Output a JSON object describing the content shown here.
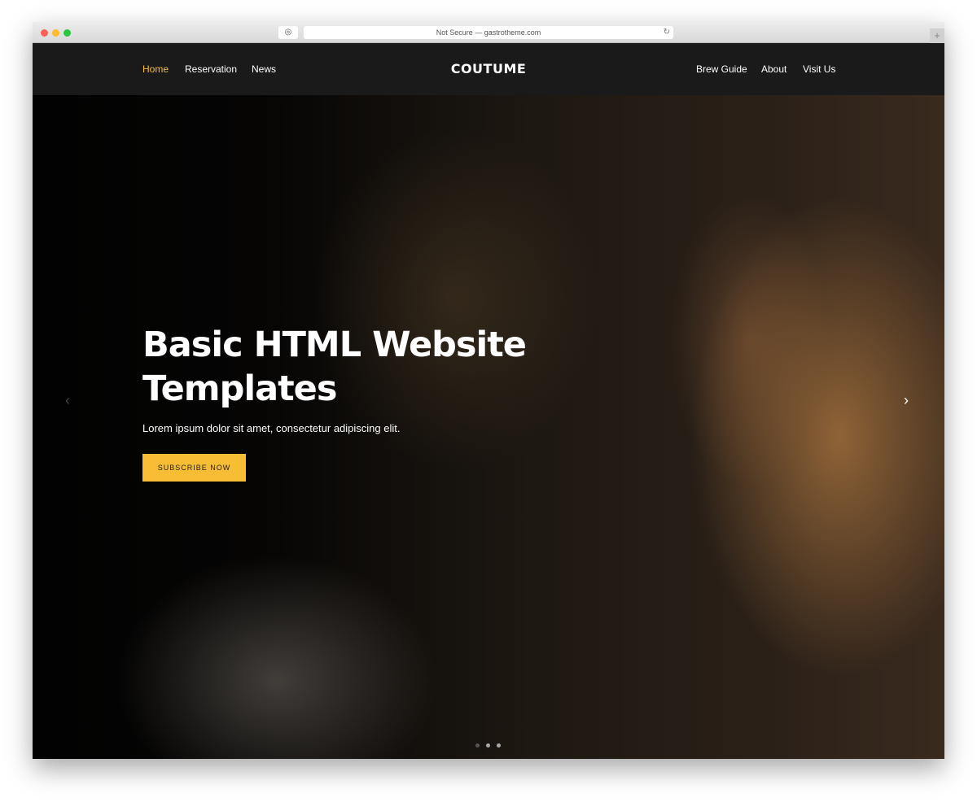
{
  "browser": {
    "url": "Not Secure — gastrotheme.com",
    "reader_icon": "reader-icon",
    "reload_icon": "reload-icon",
    "new_tab": "+"
  },
  "nav": {
    "left": [
      {
        "label": "Home",
        "active": true
      },
      {
        "label": "Reservation"
      },
      {
        "label": "News"
      }
    ],
    "logo": "COUTUME",
    "right": [
      {
        "label": "Brew Guide"
      },
      {
        "label": "About"
      },
      {
        "label": "Visit Us"
      }
    ]
  },
  "hero": {
    "title": "Basic HTML Website Templates",
    "subtitle": "Lorem ipsum dolor sit amet, consectetur adipiscing elit.",
    "button": "SUBSCRIBE NOW",
    "prev": "‹",
    "next": "›",
    "slides": 3,
    "active_slide": 1
  },
  "colors": {
    "accent": "#f7bd35",
    "nav_bg": "#1a1a1a"
  }
}
